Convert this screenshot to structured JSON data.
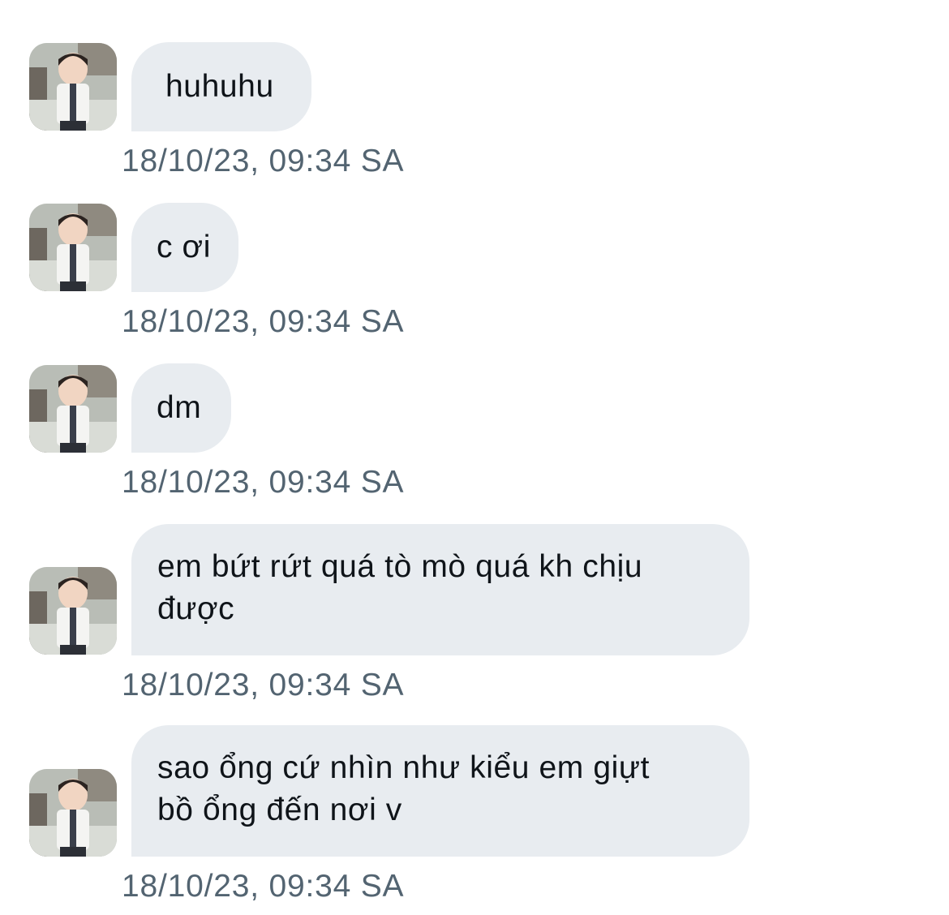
{
  "colors": {
    "bubble_bg": "#e8ecf0",
    "text": "#0f1419",
    "timestamp": "#536471",
    "background": "#ffffff"
  },
  "messages": [
    {
      "avatar_icon": "user-avatar-photo",
      "text": "huhuhu",
      "timestamp": "18/10/23, 09:34 SA"
    },
    {
      "avatar_icon": "user-avatar-photo",
      "text": "c ơi",
      "timestamp": "18/10/23, 09:34 SA"
    },
    {
      "avatar_icon": "user-avatar-photo",
      "text": "dm",
      "timestamp": "18/10/23, 09:34 SA"
    },
    {
      "avatar_icon": "user-avatar-photo",
      "text": "em bứt rứt quá tò mò quá kh chịu\nđược",
      "timestamp": "18/10/23, 09:34 SA"
    },
    {
      "avatar_icon": "user-avatar-photo",
      "text": "sao ổng cứ nhìn như kiểu em giựt\nbồ ổng đến nơi v",
      "timestamp": "18/10/23, 09:34 SA"
    }
  ]
}
